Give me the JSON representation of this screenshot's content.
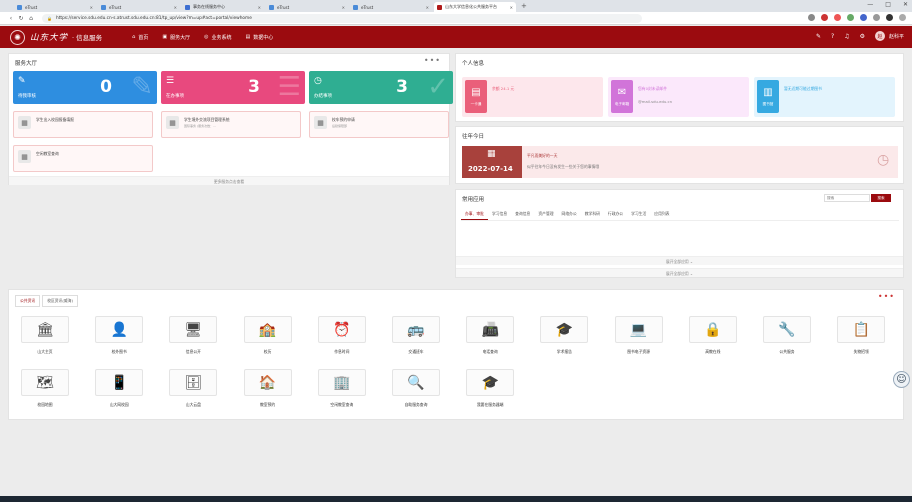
{
  "browser": {
    "tabs": [
      {
        "label": "eTrust",
        "color": "#4a8bd8",
        "active": false
      },
      {
        "label": "eTrust",
        "color": "#4a8bd8",
        "active": false
      },
      {
        "label": "事务在线服务中心",
        "color": "#3d6fd1",
        "active": false
      },
      {
        "label": "eTrust",
        "color": "#4a8bd8",
        "active": false
      },
      {
        "label": "eTrust",
        "color": "#4a8bd8",
        "active": false
      },
      {
        "label": "山东大学信息化公共服务平台",
        "color": "#b01a1a",
        "active": true
      }
    ],
    "newtab": "+",
    "url": "https://service.sdu.edu.cn-s.atrust.sdu.edu.cn:81/tp_up/view?m=up#act=portal/viewhome",
    "win": {
      "min": "—",
      "max": "□",
      "close": "✕"
    }
  },
  "header": {
    "logo_glyph": "✺",
    "university": "山东大学",
    "service": "· 信息服务",
    "nav": [
      {
        "icon": "⌂",
        "label": "首页"
      },
      {
        "icon": "▣",
        "label": "服务大厅"
      },
      {
        "icon": "◎",
        "label": "业务系统"
      },
      {
        "icon": "▤",
        "label": "数据中心"
      }
    ],
    "user_initial": "赵",
    "user_name": "赵科平"
  },
  "service_hall": {
    "title": "服务大厅",
    "more": "•••",
    "cards": [
      {
        "label": "待我审核",
        "count": "0",
        "color": "#2e8ee0",
        "icon": "✎",
        "wm": "✎"
      },
      {
        "label": "在办事项",
        "count": "3",
        "color": "#e8497e",
        "icon": "☰",
        "wm": "☰"
      },
      {
        "label": "办结事项",
        "count": "3",
        "color": "#2fae92",
        "icon": "◷",
        "wm": "✓"
      }
    ],
    "services": [
      {
        "icon": "▦",
        "text": "学生出入校园报备填报",
        "sub": ""
      },
      {
        "icon": "▦",
        "text": "学生境外交流项目管理系统",
        "sub": "国际事务 (服务次数：..."
      },
      {
        "icon": "▦",
        "text": "校车预约申请",
        "sub": "后勤保障部"
      },
      {
        "icon": "▦",
        "text": "空闲教室查询",
        "sub": ""
      }
    ],
    "more_services": "更多服务点击查看"
  },
  "personal": {
    "title": "个人信息",
    "cards": [
      {
        "box_label": "一卡通",
        "box_icon": "▤",
        "color": "#ea5f7a",
        "bg": "#fde7ec",
        "line1": "余额 24.1 元",
        "line2": ""
      },
      {
        "box_label": "电子邮箱",
        "box_icon": "✉",
        "color": "#d174d9",
        "bg": "#fbe8fb",
        "line1": "您有0封未读邮件",
        "line2": "@mail.sdu.edu.cn"
      },
      {
        "box_label": "图书馆",
        "box_icon": "▥",
        "color": "#36a9e1",
        "bg": "#e3f4fd",
        "line1": "暂无近期可能过期图书",
        "line2": ""
      }
    ]
  },
  "history": {
    "title": "往年今日",
    "date": "2022-07-14",
    "line1": "平凡而美好的一天",
    "line2": "似乎往年今日没有发生一些关于您的事情哦"
  },
  "common_apps": {
    "title": "常用应用",
    "search_placeholder": "搜索",
    "search_button": "搜索",
    "tabs": [
      "办事、审批",
      "学习信息",
      "查询信息",
      "资产管理",
      "网络办公",
      "教学科研",
      "行政办公",
      "学习生活",
      "应用列表"
    ],
    "expand1": "展开全部应用 ⌄",
    "expand2": "展开全部应用 ⌄"
  },
  "bottom": {
    "tabs": [
      "公共资讯",
      "校区资讯(威海)"
    ],
    "more": "•••",
    "apps": [
      {
        "icon": "🏛",
        "label": "山大主页"
      },
      {
        "icon": "👤",
        "label": "校外图书"
      },
      {
        "icon": "🖥",
        "label": "信息公开"
      },
      {
        "icon": "🏫",
        "label": "校历"
      },
      {
        "icon": "⏰",
        "label": "作息时间"
      },
      {
        "icon": "🚌",
        "label": "交通班车"
      },
      {
        "icon": "📠",
        "label": "电话查询"
      },
      {
        "icon": "🎓",
        "label": "学术报告"
      },
      {
        "icon": "💻",
        "label": "图书电子资源"
      },
      {
        "icon": "🔒",
        "label": "高教在线"
      },
      {
        "icon": "🔧",
        "label": "公共服务"
      },
      {
        "icon": "📋",
        "label": "失物招领"
      },
      {
        "icon": "🗺",
        "label": "校园地图"
      },
      {
        "icon": "📱",
        "label": "山大网校园"
      },
      {
        "icon": "🗄",
        "label": "山大云盘"
      },
      {
        "icon": "🏠",
        "label": "教室预约"
      },
      {
        "icon": "🏢",
        "label": "空闲教室查询"
      },
      {
        "icon": "🔍",
        "label": "自助服务查询"
      },
      {
        "icon": "🎓",
        "label": "我要在服务器端"
      }
    ]
  },
  "float_avatar": "☺"
}
